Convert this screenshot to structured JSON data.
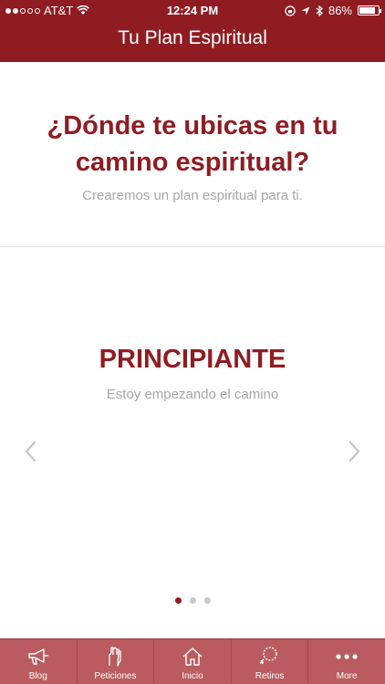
{
  "status_bar": {
    "carrier": "AT&T",
    "time": "12:24 PM",
    "battery": "86%",
    "signal_bars_filled": 2,
    "signal_bars_total": 5,
    "battery_level": 0.86
  },
  "header": {
    "title": "Tu Plan Espiritual"
  },
  "intro": {
    "question": "¿Dónde te ubicas en tu camino espiritual?",
    "subtitle": "Crearemos un plan espiritual para ti."
  },
  "carousel": {
    "current_page": 1,
    "page_count": 3,
    "level_title": "PRINCIPIANTE",
    "level_description": "Estoy empezando el camino"
  },
  "tabs": [
    {
      "label": "Blog",
      "icon": "megaphone-icon"
    },
    {
      "label": "Peticiones",
      "icon": "praying-hands-icon"
    },
    {
      "label": "Inicio",
      "icon": "home-icon"
    },
    {
      "label": "Retiros",
      "icon": "rosary-icon"
    },
    {
      "label": "More",
      "icon": "more-dots-icon"
    }
  ],
  "colors": {
    "brand": "#8f1c22",
    "tabbar": "#b95b5f",
    "muted_text": "#a6a6a6"
  }
}
